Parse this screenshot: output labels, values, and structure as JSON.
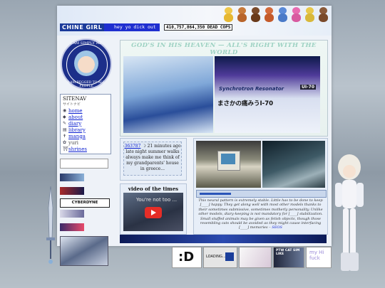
{
  "header": {
    "site_title": "CHINE GIRL",
    "marquee_text": "hey yo dick out",
    "counter_text": "410,757,864,350 DEAD COPS"
  },
  "seal": {
    "text_top": "I AM SIMPLY ME",
    "text_bottom": "I AM BEGGED TO ALL PEOPLE"
  },
  "sitenav": {
    "heading": "SITENAV",
    "subheading": "サイトナビ",
    "items": [
      {
        "label": "home",
        "icon": "globe-icon"
      },
      {
        "label": "about",
        "icon": "info-icon"
      },
      {
        "label": "diary",
        "icon": "pencil-icon"
      },
      {
        "label": "library",
        "icon": "book-icon"
      },
      {
        "label": "manga",
        "icon": "cross-icon"
      },
      {
        "label": "yuri",
        "icon": "flower-icon"
      },
      {
        "label": "shrines",
        "icon": "shrine-icon"
      }
    ]
  },
  "buttons_88x31": {
    "cyberdyne": "CYBERDYNE"
  },
  "banner": {
    "title": "GOD'S IN HIS HEAVEN — ALL'S RIGHT WITH THE WORLD",
    "right_logo": "Synchrotron Resonator",
    "right_version": "UI-70",
    "right_jp": "まさかの痛みうI-70"
  },
  "status": {
    "id": "363787",
    "time": "21 minutes ago",
    "text": "late night summer walks always make me think of my grandparents' house in greece..."
  },
  "video": {
    "title": "video of the times",
    "caption": "You're not too ..."
  },
  "photo_caption": {
    "text": "This neural pattern is extremely stable. Little has to be done to keep [____] happy. They get along well with most other models thanks to their sometimes submissive, sometimes motherly personality. Unlike other models, diary-keeping is not mandatory for [____] stabilization. Small stuffed animals may be given as fetish objects, though those resembling cats should be avoided as they might cause interfacing [____] memories –",
    "link": "SEOS"
  },
  "footer": {
    "btn1": ":D",
    "btn2": "LOADING...",
    "btn4": "PTW CAT SIM LIKE",
    "btn5": "my Hi fuck"
  },
  "colors": {
    "accent": "#1f2fd0",
    "link": "#0b1fd0",
    "banner_title": "#9ed2c3"
  }
}
